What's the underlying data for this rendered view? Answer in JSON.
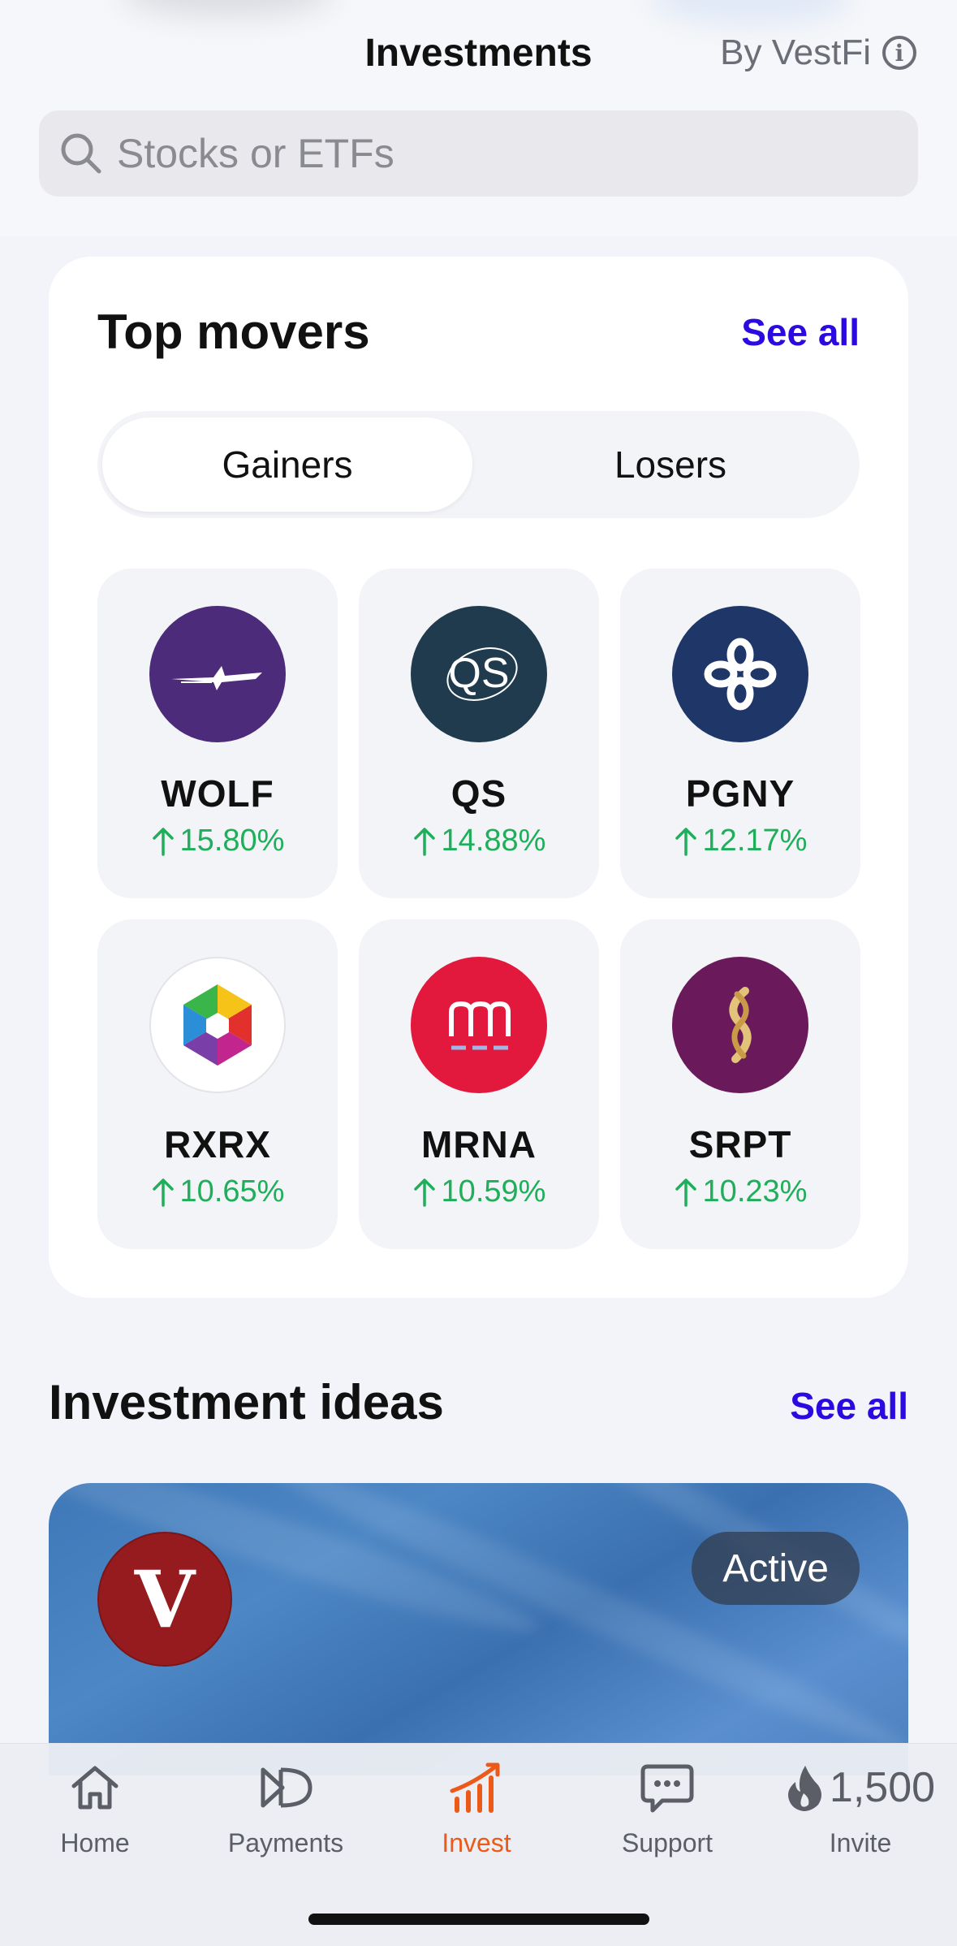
{
  "header": {
    "title": "Investments",
    "provider": "By VestFi"
  },
  "search": {
    "placeholder": "Stocks or ETFs"
  },
  "top_movers": {
    "title": "Top movers",
    "see_all": "See all",
    "segments": [
      "Gainers",
      "Losers"
    ],
    "selected_segment": "Gainers",
    "items": [
      {
        "ticker": "WOLF",
        "change": "15.80%",
        "logo_color": "#4b2b7a"
      },
      {
        "ticker": "QS",
        "change": "14.88%",
        "logo_color": "#1f3b4d"
      },
      {
        "ticker": "PGNY",
        "change": "12.17%",
        "logo_color": "#1e3768"
      },
      {
        "ticker": "RXRX",
        "change": "10.65%",
        "logo_color": "#ffffff"
      },
      {
        "ticker": "MRNA",
        "change": "10.59%",
        "logo_color": "#e2183d"
      },
      {
        "ticker": "SRPT",
        "change": "10.23%",
        "logo_color": "#6a1a5a"
      }
    ]
  },
  "investment_ideas": {
    "title": "Investment ideas",
    "see_all": "See all",
    "card": {
      "logo_letter": "V",
      "status": "Active"
    }
  },
  "tabbar": {
    "tabs": [
      {
        "label": "Home",
        "icon": "home-icon"
      },
      {
        "label": "Payments",
        "icon": "payments-icon"
      },
      {
        "label": "Invest",
        "icon": "invest-icon"
      },
      {
        "label": "Support",
        "icon": "support-icon"
      },
      {
        "label": "Invite",
        "icon": "flame-icon",
        "count": "1,500"
      }
    ],
    "active_tab": "Invest"
  },
  "colors": {
    "accent_link": "#2a0ae0",
    "gain": "#1fae5a",
    "active_tab": "#ec5a17"
  }
}
